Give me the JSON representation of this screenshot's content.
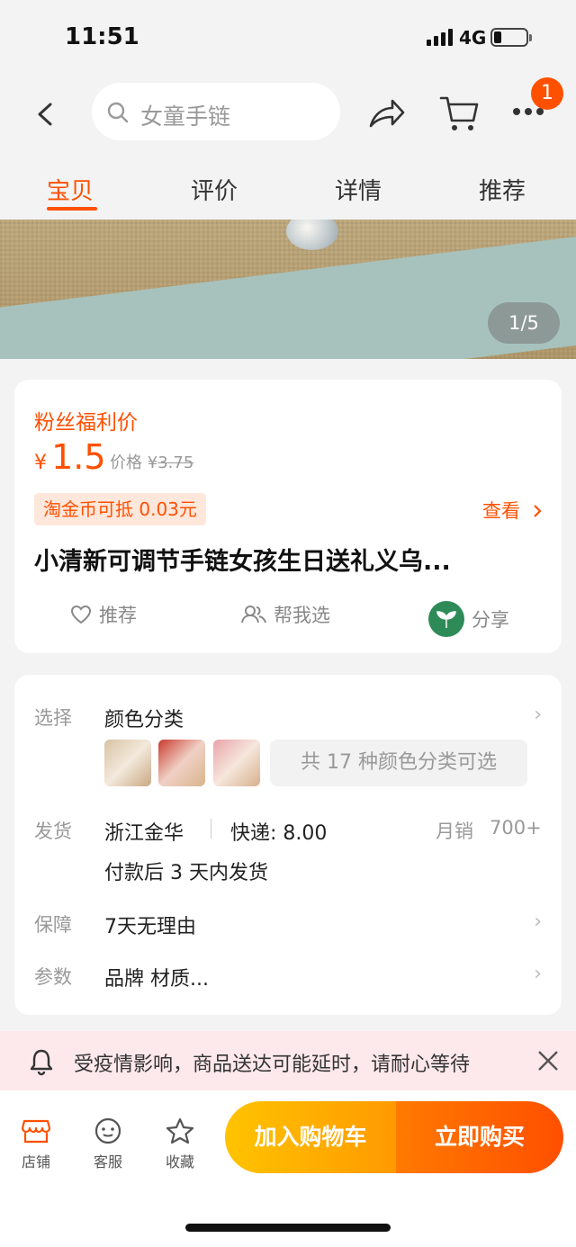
{
  "status_bar": {
    "time": "11:51",
    "network": "4G"
  },
  "header": {
    "search_placeholder": "女童手链",
    "cart_badge": "1"
  },
  "tabs": [
    {
      "label": "宝贝",
      "active": true
    },
    {
      "label": "评价",
      "active": false
    },
    {
      "label": "详情",
      "active": false
    },
    {
      "label": "推荐",
      "active": false
    }
  ],
  "gallery": {
    "counter": "1/5"
  },
  "price_card": {
    "promo_label": "粉丝福利价",
    "currency": "¥",
    "price": "1.5",
    "original_label": "价格",
    "original_currency": "¥",
    "original_price": "3.75",
    "coin_tag": "淘金币可抵 0.03元",
    "view_link": "查看",
    "title": "小清新可调节手链女孩生日送礼义乌...",
    "actions": {
      "recommend": "推荐",
      "help_choose": "帮我选",
      "share": "分享"
    }
  },
  "details": {
    "select_label": "选择",
    "select_value": "颜色分类",
    "more_colors": "共 17 种颜色分类可选",
    "ship_label": "发货",
    "ship_origin": "浙江金华",
    "ship_fee": "快递: 8.00",
    "monthly_sales_label": "月销",
    "monthly_sales": "700+",
    "ship_time": "付款后 3 天内发货",
    "guarantee_label": "保障",
    "guarantee_value": "7天无理由",
    "params_label": "参数",
    "params_value": "品牌 材质..."
  },
  "notice": {
    "text": "受疫情影响，商品送达可能延时，请耐心等待"
  },
  "bottom_bar": {
    "store": "店铺",
    "service": "客服",
    "favorite": "收藏",
    "add_to_cart": "加入购物车",
    "buy_now": "立即购买"
  },
  "colors": {
    "accent": "#ff5000",
    "cart_button": "#ffb300",
    "buy_button": "#ff5a00"
  }
}
